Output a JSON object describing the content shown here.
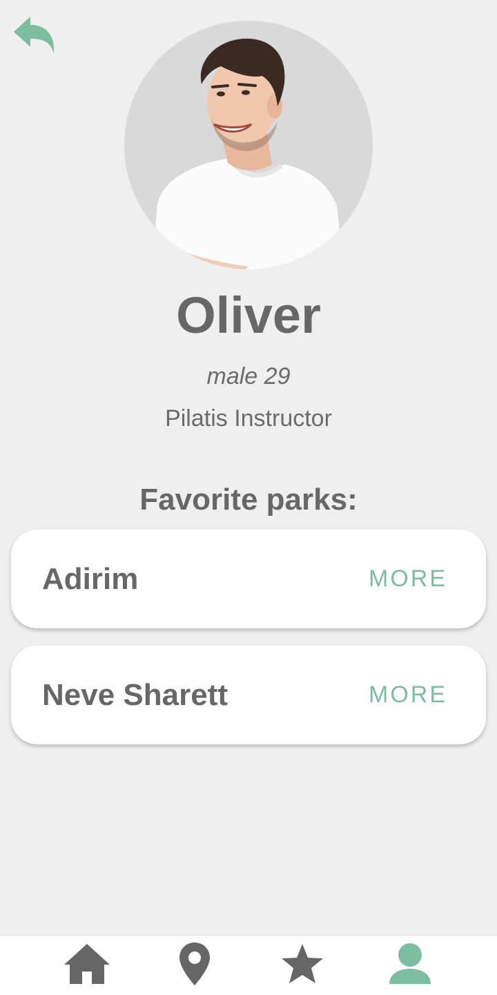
{
  "colors": {
    "background": "#efefef",
    "accent": "#7dbd9f",
    "text": "#676767",
    "card": "#ffffff",
    "nav_inactive": "#666666"
  },
  "header": {
    "back_icon": "reply-arrow-icon"
  },
  "profile": {
    "avatar_description_icon": "profile-photo",
    "name": "Oliver",
    "meta": "male 29",
    "occupation": "Pilatis Instructor"
  },
  "favorites": {
    "heading": "Favorite parks:",
    "parks": [
      {
        "name": "Adirim",
        "action_label": "MORE"
      },
      {
        "name": "Neve Sharett",
        "action_label": "MORE"
      }
    ]
  },
  "bottom_nav": {
    "items": [
      {
        "icon": "home-icon",
        "active": false
      },
      {
        "icon": "map-pin-icon",
        "active": false
      },
      {
        "icon": "star-icon",
        "active": false
      },
      {
        "icon": "person-icon",
        "active": true
      }
    ]
  }
}
